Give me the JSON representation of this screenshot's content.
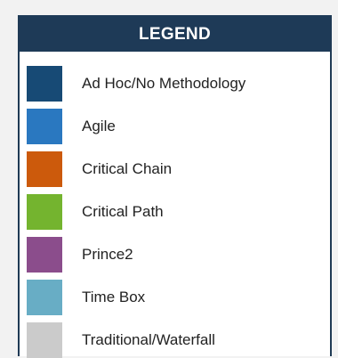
{
  "chart_data": {
    "type": "legend",
    "title": "LEGEND",
    "entries": [
      {
        "label": "Ad Hoc/No Methodology",
        "color": "#174a75"
      },
      {
        "label": "Agile",
        "color": "#2a78c0"
      },
      {
        "label": "Critical Chain",
        "color": "#cc5a0c"
      },
      {
        "label": "Critical Path",
        "color": "#74b42f"
      },
      {
        "label": "Prince2",
        "color": "#8b4d8c"
      },
      {
        "label": "Time Box",
        "color": "#68adc5"
      },
      {
        "label": "Traditional/Waterfall",
        "color": "#cbcbcb"
      }
    ]
  }
}
